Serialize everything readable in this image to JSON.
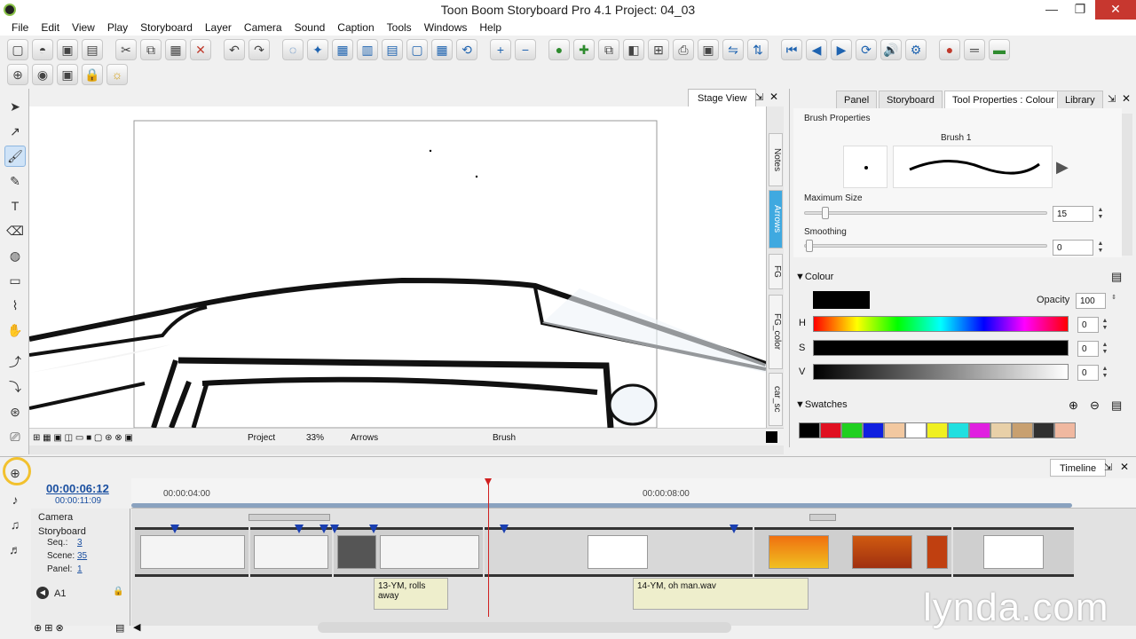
{
  "window": {
    "title": "Toon Boom Storyboard Pro 4.1 Project: 04_03"
  },
  "menu": [
    "File",
    "Edit",
    "View",
    "Play",
    "Storyboard",
    "Layer",
    "Camera",
    "Sound",
    "Caption",
    "Tools",
    "Windows",
    "Help"
  ],
  "stage": {
    "tab_label": "Stage View",
    "side_tabs": [
      "Notes",
      "Arrows",
      "FG",
      "FG_color",
      "car_sc"
    ],
    "active_side_tab": "Arrows",
    "status": {
      "project": "Project",
      "zoom": "33%",
      "layer": "Arrows",
      "tool": "Brush"
    }
  },
  "right_panel": {
    "tabs": [
      "Panel",
      "Storyboard",
      "Tool Properties : Colour",
      "Library"
    ],
    "active_tab": "Tool Properties : Colour",
    "brush": {
      "section_title": "Brush Properties",
      "name": "Brush 1",
      "max_size_label": "Maximum Size",
      "max_size_value": "15",
      "smoothing_label": "Smoothing",
      "smoothing_value": "0"
    },
    "colour": {
      "section_title": "Colour",
      "opacity_label": "Opacity",
      "opacity_value": "100",
      "h_label": "H",
      "h_value": "0",
      "s_label": "S",
      "s_value": "0",
      "v_label": "V",
      "v_value": "0",
      "current": "#000000"
    },
    "swatches": {
      "section_title": "Swatches",
      "colors": [
        "#000000",
        "#e01020",
        "#20d020",
        "#1020e0",
        "#f2c8a0",
        "#ffffff",
        "#f0f020",
        "#20e0e0",
        "#e020e0",
        "#e8d0a8",
        "#c8a070",
        "#303030",
        "#f0b8a0"
      ]
    }
  },
  "timeline": {
    "tab_label": "Timeline",
    "current_time": "00:00:06:12",
    "total_time": "00:00:11:09",
    "ruler": [
      "00:00:04:00",
      "00:00:08:00"
    ],
    "rows": {
      "camera": "Camera",
      "storyboard": "Storyboard",
      "seq_label": "Seq.:",
      "seq_value": "3",
      "scene_label": "Scene:",
      "scene_value": "35",
      "panel_label": "Panel:",
      "panel_value": "1",
      "audio": "A1"
    },
    "audio_clips": [
      "13-YM, rolls away",
      "14-YM, oh man.wav"
    ]
  },
  "watermark": "lynda.com"
}
